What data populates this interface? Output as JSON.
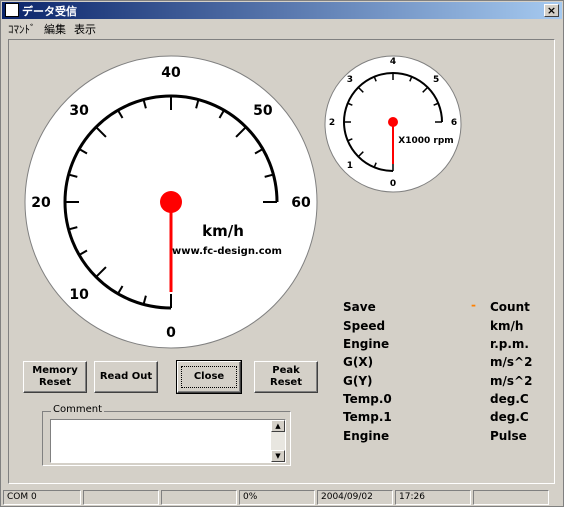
{
  "window": {
    "title": "データ受信",
    "close_label": "×"
  },
  "menu": [
    "ｺﾏﾝﾄﾞ",
    "編集",
    "表示"
  ],
  "speed_gauge": {
    "unit": "km/h",
    "site": "www.fc-design.com",
    "tick_labels": [
      "0",
      "10",
      "20",
      "30",
      "40",
      "50",
      "60"
    ],
    "value": 0,
    "needle_color": "#ff0000"
  },
  "rpm_gauge": {
    "unit": "X1000 rpm",
    "tick_labels": [
      "0",
      "1",
      "2",
      "3",
      "4",
      "5",
      "6"
    ],
    "value": 0,
    "needle_color": "#ff0000"
  },
  "buttons": {
    "memory_reset": "Memory\nReset",
    "read_out": "Read Out",
    "close": "Close",
    "peak_reset": "Peak Reset"
  },
  "comment": {
    "label": "Comment",
    "value": ""
  },
  "info": {
    "rows": [
      {
        "name": "Save",
        "value": "Count",
        "marker": "-"
      },
      {
        "name": "Speed",
        "value": "km/h"
      },
      {
        "name": "Engine",
        "value": "r.p.m."
      },
      {
        "name": "G(X)",
        "value": "m/s^2"
      },
      {
        "name": "G(Y)",
        "value": "m/s^2"
      },
      {
        "name": "Temp.0",
        "value": "deg.C"
      },
      {
        "name": "Temp.1",
        "value": "deg.C"
      },
      {
        "name": "Engine",
        "value": "Pulse"
      }
    ],
    "marker_color": "#ff8000"
  },
  "status": {
    "port": "COM 0",
    "progress": "0%",
    "date": "2004/09/02",
    "time": "17:26"
  }
}
